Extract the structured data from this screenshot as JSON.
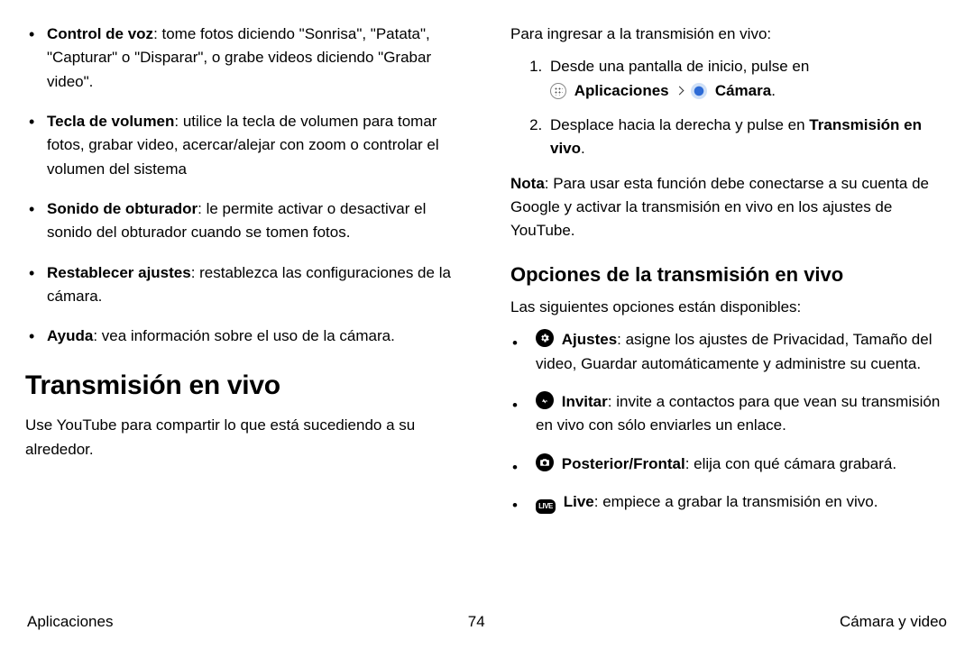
{
  "left": {
    "bullets": {
      "voice": {
        "label": "Control de voz",
        "text": ": tome fotos diciendo \"Sonrisa\", \"Patata\", \"Capturar\" o \"Disparar\", o grabe videos diciendo \"Grabar video\"."
      },
      "volume": {
        "label": "Tecla de volumen",
        "text": ": utilice la tecla de volumen para tomar fotos, grabar video, acercar/alejar con zoom o controlar el volumen del sistema"
      },
      "shutter": {
        "label": "Sonido de obturador",
        "text": ": le permite activar o desactivar el sonido del obturador cuando se tomen fotos."
      },
      "reset": {
        "label": "Restablecer ajustes",
        "text": ": restablezca las configuraciones de la cámara."
      },
      "help": {
        "label": "Ayuda",
        "text": ": vea información sobre el uso de la cámara."
      }
    },
    "h2": "Transmisión en vivo",
    "sub": "Use YouTube para compartir lo que está sucediendo a su alrededor."
  },
  "right": {
    "intro": "Para ingresar a la transmisión en vivo:",
    "ol1": "Desde una pantalla de inicio, pulse en",
    "ol1_apps": "Aplicaciones",
    "ol1_cam": "Cámara",
    "ol2a": "Desplace hacia la derecha y pulse en ",
    "ol2b": "Transmisión en vivo",
    "noteLabel": "Nota",
    "noteText": ": Para usar esta función debe conectarse a su cuenta de Google y activar la transmisión en vivo en los ajustes de YouTube.",
    "h3": "Opciones de la transmisión en vivo",
    "optIntro": "Las siguientes opciones están disponibles:",
    "opts": {
      "settings": {
        "label": "Ajustes",
        "text": ": asigne los ajustes de Privacidad, Tamaño del video, Guardar automáticamente y administre su cuenta."
      },
      "invite": {
        "label": "Invitar",
        "text": ": invite a contactos para que vean su transmisión en vivo con sólo enviarles un enlace."
      },
      "camera": {
        "label": "Posterior/Frontal",
        "text": ": elija con qué cámara grabará."
      },
      "live": {
        "label": "Live",
        "text": ": empiece a grabar la transmisión en vivo.",
        "icon_text": "LIVE"
      }
    }
  },
  "footer": {
    "left": "Aplicaciones",
    "page": "74",
    "right": "Cámara y video"
  }
}
